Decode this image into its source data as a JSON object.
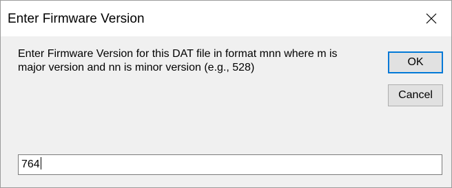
{
  "dialog": {
    "title": "Enter Firmware Version",
    "close_icon": "close-icon",
    "prompt": "Enter Firmware Version for this DAT file in format mnn where m is major version and nn is minor version (e.g., 528)",
    "buttons": {
      "ok_label": "OK",
      "cancel_label": "Cancel"
    },
    "input": {
      "value": "764"
    }
  },
  "colors": {
    "title_bar": "#ffffff",
    "client": "#f0f0f0",
    "default_button_border": "#0078d7",
    "button_face": "#e1e1e1"
  }
}
